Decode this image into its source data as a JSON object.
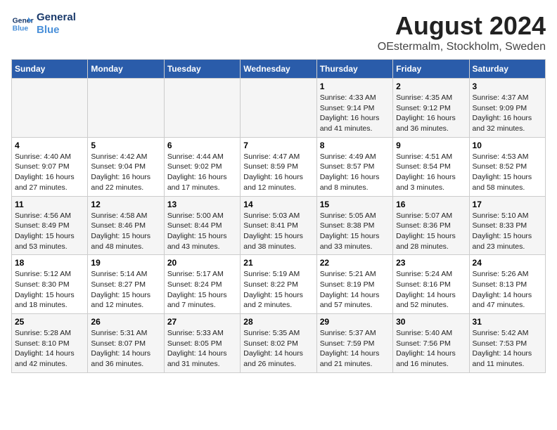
{
  "logo": {
    "line1": "General",
    "line2": "Blue"
  },
  "title": "August 2024",
  "subtitle": "OEstermalm, Stockholm, Sweden",
  "days_of_week": [
    "Sunday",
    "Monday",
    "Tuesday",
    "Wednesday",
    "Thursday",
    "Friday",
    "Saturday"
  ],
  "weeks": [
    [
      {
        "day": "",
        "content": ""
      },
      {
        "day": "",
        "content": ""
      },
      {
        "day": "",
        "content": ""
      },
      {
        "day": "",
        "content": ""
      },
      {
        "day": "1",
        "content": "Sunrise: 4:33 AM\nSunset: 9:14 PM\nDaylight: 16 hours\nand 41 minutes."
      },
      {
        "day": "2",
        "content": "Sunrise: 4:35 AM\nSunset: 9:12 PM\nDaylight: 16 hours\nand 36 minutes."
      },
      {
        "day": "3",
        "content": "Sunrise: 4:37 AM\nSunset: 9:09 PM\nDaylight: 16 hours\nand 32 minutes."
      }
    ],
    [
      {
        "day": "4",
        "content": "Sunrise: 4:40 AM\nSunset: 9:07 PM\nDaylight: 16 hours\nand 27 minutes."
      },
      {
        "day": "5",
        "content": "Sunrise: 4:42 AM\nSunset: 9:04 PM\nDaylight: 16 hours\nand 22 minutes."
      },
      {
        "day": "6",
        "content": "Sunrise: 4:44 AM\nSunset: 9:02 PM\nDaylight: 16 hours\nand 17 minutes."
      },
      {
        "day": "7",
        "content": "Sunrise: 4:47 AM\nSunset: 8:59 PM\nDaylight: 16 hours\nand 12 minutes."
      },
      {
        "day": "8",
        "content": "Sunrise: 4:49 AM\nSunset: 8:57 PM\nDaylight: 16 hours\nand 8 minutes."
      },
      {
        "day": "9",
        "content": "Sunrise: 4:51 AM\nSunset: 8:54 PM\nDaylight: 16 hours\nand 3 minutes."
      },
      {
        "day": "10",
        "content": "Sunrise: 4:53 AM\nSunset: 8:52 PM\nDaylight: 15 hours\nand 58 minutes."
      }
    ],
    [
      {
        "day": "11",
        "content": "Sunrise: 4:56 AM\nSunset: 8:49 PM\nDaylight: 15 hours\nand 53 minutes."
      },
      {
        "day": "12",
        "content": "Sunrise: 4:58 AM\nSunset: 8:46 PM\nDaylight: 15 hours\nand 48 minutes."
      },
      {
        "day": "13",
        "content": "Sunrise: 5:00 AM\nSunset: 8:44 PM\nDaylight: 15 hours\nand 43 minutes."
      },
      {
        "day": "14",
        "content": "Sunrise: 5:03 AM\nSunset: 8:41 PM\nDaylight: 15 hours\nand 38 minutes."
      },
      {
        "day": "15",
        "content": "Sunrise: 5:05 AM\nSunset: 8:38 PM\nDaylight: 15 hours\nand 33 minutes."
      },
      {
        "day": "16",
        "content": "Sunrise: 5:07 AM\nSunset: 8:36 PM\nDaylight: 15 hours\nand 28 minutes."
      },
      {
        "day": "17",
        "content": "Sunrise: 5:10 AM\nSunset: 8:33 PM\nDaylight: 15 hours\nand 23 minutes."
      }
    ],
    [
      {
        "day": "18",
        "content": "Sunrise: 5:12 AM\nSunset: 8:30 PM\nDaylight: 15 hours\nand 18 minutes."
      },
      {
        "day": "19",
        "content": "Sunrise: 5:14 AM\nSunset: 8:27 PM\nDaylight: 15 hours\nand 12 minutes."
      },
      {
        "day": "20",
        "content": "Sunrise: 5:17 AM\nSunset: 8:24 PM\nDaylight: 15 hours\nand 7 minutes."
      },
      {
        "day": "21",
        "content": "Sunrise: 5:19 AM\nSunset: 8:22 PM\nDaylight: 15 hours\nand 2 minutes."
      },
      {
        "day": "22",
        "content": "Sunrise: 5:21 AM\nSunset: 8:19 PM\nDaylight: 14 hours\nand 57 minutes."
      },
      {
        "day": "23",
        "content": "Sunrise: 5:24 AM\nSunset: 8:16 PM\nDaylight: 14 hours\nand 52 minutes."
      },
      {
        "day": "24",
        "content": "Sunrise: 5:26 AM\nSunset: 8:13 PM\nDaylight: 14 hours\nand 47 minutes."
      }
    ],
    [
      {
        "day": "25",
        "content": "Sunrise: 5:28 AM\nSunset: 8:10 PM\nDaylight: 14 hours\nand 42 minutes."
      },
      {
        "day": "26",
        "content": "Sunrise: 5:31 AM\nSunset: 8:07 PM\nDaylight: 14 hours\nand 36 minutes."
      },
      {
        "day": "27",
        "content": "Sunrise: 5:33 AM\nSunset: 8:05 PM\nDaylight: 14 hours\nand 31 minutes."
      },
      {
        "day": "28",
        "content": "Sunrise: 5:35 AM\nSunset: 8:02 PM\nDaylight: 14 hours\nand 26 minutes."
      },
      {
        "day": "29",
        "content": "Sunrise: 5:37 AM\nSunset: 7:59 PM\nDaylight: 14 hours\nand 21 minutes."
      },
      {
        "day": "30",
        "content": "Sunrise: 5:40 AM\nSunset: 7:56 PM\nDaylight: 14 hours\nand 16 minutes."
      },
      {
        "day": "31",
        "content": "Sunrise: 5:42 AM\nSunset: 7:53 PM\nDaylight: 14 hours\nand 11 minutes."
      }
    ]
  ]
}
